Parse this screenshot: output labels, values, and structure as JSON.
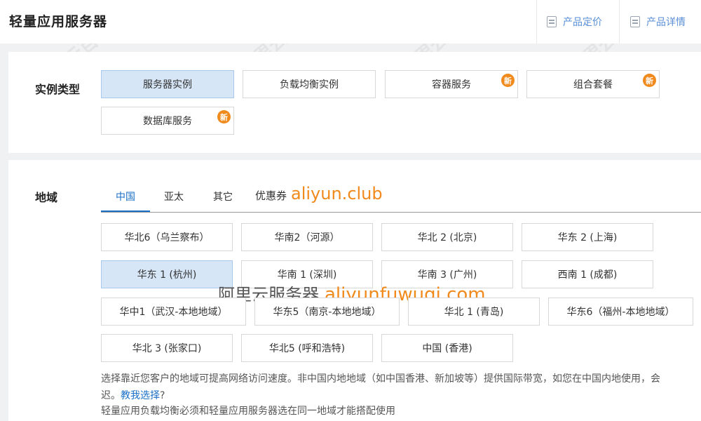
{
  "header": {
    "title": "轻量应用服务器",
    "links": [
      {
        "label": "产品定价",
        "icon": "pricing-doc-icon"
      },
      {
        "label": "产品详情",
        "icon": "details-doc-icon"
      }
    ]
  },
  "instance_type": {
    "label": "实例类型",
    "options": [
      {
        "label": "服务器实例",
        "selected": true,
        "badge": ""
      },
      {
        "label": "负载均衡实例",
        "selected": false,
        "badge": ""
      },
      {
        "label": "容器服务",
        "selected": false,
        "badge": "新"
      },
      {
        "label": "组合套餐",
        "selected": false,
        "badge": "新"
      },
      {
        "label": "数据库服务",
        "selected": false,
        "badge": "新"
      }
    ]
  },
  "region": {
    "label": "地域",
    "tabs": [
      {
        "label": "中国",
        "active": true
      },
      {
        "label": "亚太",
        "active": false
      },
      {
        "label": "其它",
        "active": false
      }
    ],
    "coupon_text": "优惠券",
    "coupon_site": "aliyun.club",
    "watermark_text": "阿里云服务器",
    "watermark_site": "aliyunfuwuqi.com",
    "options": [
      {
        "label": "华北6（乌兰察布）",
        "selected": false
      },
      {
        "label": "华南2（河源）",
        "selected": false
      },
      {
        "label": "华北 2 (北京)",
        "selected": false
      },
      {
        "label": "华东 2 (上海)",
        "selected": false
      },
      {
        "label": "华东 1 (杭州)",
        "selected": true
      },
      {
        "label": "华南 1 (深圳)",
        "selected": false
      },
      {
        "label": "华南 3 (广州)",
        "selected": false
      },
      {
        "label": "西南 1 (成都)",
        "selected": false
      },
      {
        "label": "华中1（武汉-本地地域）",
        "selected": false
      },
      {
        "label": "华东5（南京-本地地域）",
        "selected": false
      },
      {
        "label": "华北 1 (青岛)",
        "selected": false
      },
      {
        "label": "华东6（福州-本地地域）",
        "selected": false
      },
      {
        "label": "华北 3 (张家口)",
        "selected": false
      },
      {
        "label": "华北5 (呼和浩特)",
        "selected": false
      },
      {
        "label": "中国 (香港)",
        "selected": false
      }
    ],
    "description_line1": "选择靠近您客户的地域可提高网络访问速度。非中国内地地域（如中国香港、新加坡等）提供国际带宽，如您在中国内地使用，会",
    "description_line2_prefix": "迟。",
    "description_link": "教我选择",
    "description_line2_suffix": "?",
    "description_line3": "轻量应用负载均衡必须和轻量应用服务器选在同一地域才能搭配使用"
  },
  "background_watermark": "阿里云百科"
}
